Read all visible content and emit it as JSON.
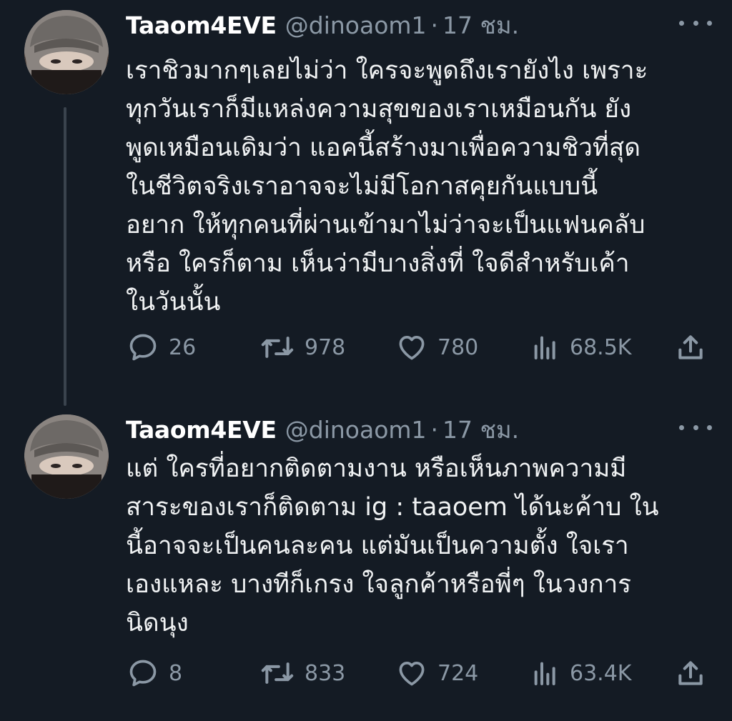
{
  "tweets": [
    {
      "name": "Taaom4EVE",
      "handle": "@dinoaom1",
      "separator": "·",
      "time": "17 ชม.",
      "lines": [
        "เราชิวมากๆเลยไม่ว่า ใครจะพูดถึงเรายังไง เพราะ",
        "ทุกวันเราก็มีแหล่งความสุขของเราเหมือนกัน ยัง",
        "พูดเหมือนเดิมว่า แอคนี้สร้างมาเพื่อความชิวที่สุด",
        "ในชีวิตจริงเราอาจจะไม่มีโอกาสคุยกันแบบนี้",
        "อยาก ให้ทุกคนที่ผ่านเข้ามาไม่ว่าจะเป็นแฟนคลับ",
        "หรือ ใครก็ตาม เห็นว่ามีบางสิ่งที่ ใจดีสำหรับเค้า",
        "ในวันนั้น"
      ],
      "replies": "26",
      "retweets": "978",
      "likes": "780",
      "views": "68.5K"
    },
    {
      "name": "Taaom4EVE",
      "handle": "@dinoaom1",
      "separator": "·",
      "time": "17 ชม.",
      "lines": [
        "แต่ ใครที่อยากติดตามงาน หรือเห็นภาพความมี",
        "สาระของเราก็ติดตาม ig : taaoem ได้นะค้าบ ใน",
        "นี้อาจจะเป็นคนละคน แต่มันเป็นความตั้ง ใจเรา",
        "เองแหละ บางทีก็เกรง ใจลูกค้าหรือพี่ๆ ในวงการ",
        "นิดนุง"
      ],
      "replies": "8",
      "retweets": "833",
      "likes": "724",
      "views": "63.4K"
    }
  ],
  "icons": {
    "reply": "reply-icon",
    "retweet": "retweet-icon",
    "like": "heart-icon",
    "views": "views-icon",
    "share": "share-icon",
    "more": "more-icon"
  },
  "colors": {
    "background": "#141b24",
    "muted": "#8b98a5",
    "thread_line": "#3a434d"
  }
}
